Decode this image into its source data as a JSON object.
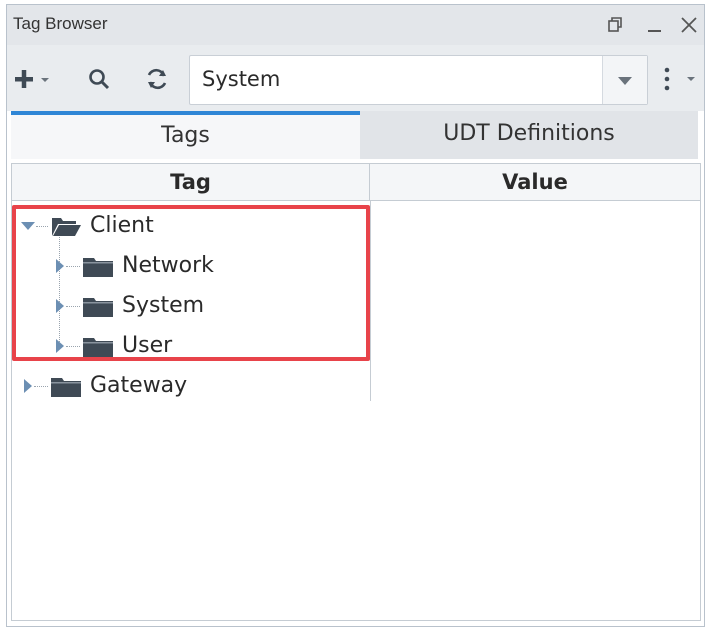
{
  "window": {
    "title": "Tag Browser",
    "controls": [
      "restore-icon",
      "minimize-icon",
      "close-icon"
    ]
  },
  "toolbar": {
    "add_icon": "plus-icon",
    "search_icon": "search-icon",
    "refresh_icon": "refresh-icon",
    "provider_selected": "System",
    "more_icon": "vertical-dots-icon"
  },
  "tabs": [
    {
      "label": "Tags",
      "active": true
    },
    {
      "label": "UDT Definitions",
      "active": false
    }
  ],
  "table": {
    "columns": [
      "Tag",
      "Value"
    ],
    "rows": [
      {
        "label": "Client",
        "level": 0,
        "expanded": true,
        "icon": "folder-open-icon"
      },
      {
        "label": "Network",
        "level": 1,
        "expanded": false,
        "icon": "folder-icon"
      },
      {
        "label": "System",
        "level": 1,
        "expanded": false,
        "icon": "folder-icon"
      },
      {
        "label": "User",
        "level": 1,
        "expanded": false,
        "icon": "folder-icon"
      },
      {
        "label": "Gateway",
        "level": 0,
        "expanded": false,
        "icon": "folder-icon"
      }
    ]
  },
  "colors": {
    "accent_tab": "#2f86d6",
    "highlight_box": "#e8434a",
    "folder": "#3f4a55"
  }
}
